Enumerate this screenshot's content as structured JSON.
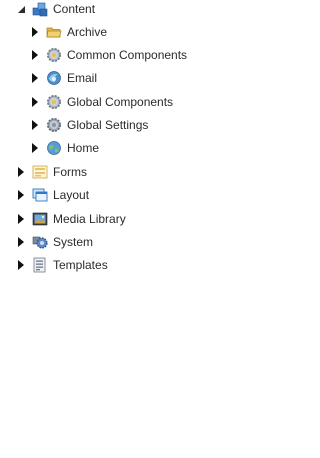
{
  "tree": {
    "root": {
      "label": "Content",
      "icon": "content-icon",
      "expanded": true
    },
    "content_children": [
      {
        "label": "Archive",
        "icon": "folder-icon"
      },
      {
        "label": "Common Components",
        "icon": "gear-icon"
      },
      {
        "label": "Email",
        "icon": "email-icon"
      },
      {
        "label": "Global Components",
        "icon": "gear-icon"
      },
      {
        "label": "Global Settings",
        "icon": "gear-icon"
      },
      {
        "label": "Home",
        "icon": "home-icon"
      }
    ],
    "siblings": [
      {
        "label": "Forms",
        "icon": "forms-icon"
      },
      {
        "label": "Layout",
        "icon": "layout-icon"
      },
      {
        "label": "Media Library",
        "icon": "media-library-icon"
      },
      {
        "label": "System",
        "icon": "system-icon"
      },
      {
        "label": "Templates",
        "icon": "templates-icon"
      }
    ]
  }
}
